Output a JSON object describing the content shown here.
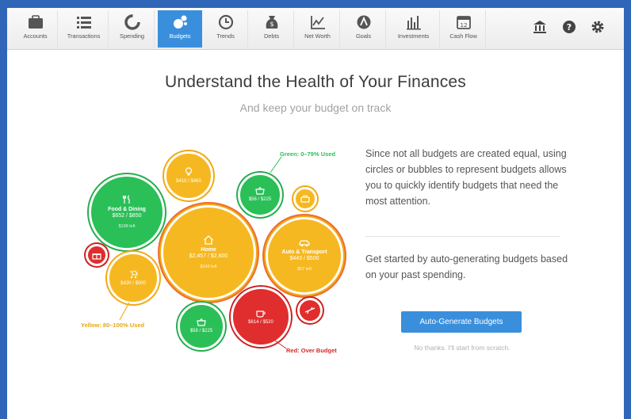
{
  "nav": {
    "tabs": [
      {
        "label": "Accounts",
        "icon": "briefcase-icon"
      },
      {
        "label": "Transactions",
        "icon": "list-icon"
      },
      {
        "label": "Spending",
        "icon": "pie-chart-icon"
      },
      {
        "label": "Budgets",
        "icon": "bubbles-icon",
        "active": true
      },
      {
        "label": "Trends",
        "icon": "clock-icon"
      },
      {
        "label": "Debts",
        "icon": "money-bag-icon"
      },
      {
        "label": "Net Worth",
        "icon": "line-chart-icon"
      },
      {
        "label": "Goals",
        "icon": "goal-icon"
      },
      {
        "label": "Investments",
        "icon": "bar-chart-icon"
      },
      {
        "label": "Cash Flow",
        "icon": "calendar-icon"
      }
    ],
    "tools": [
      {
        "icon": "bank-icon"
      },
      {
        "icon": "help-icon"
      },
      {
        "icon": "settings-icon"
      }
    ]
  },
  "header": {
    "title": "Understand the Health of Your Finances",
    "subtitle": "And keep your budget on track"
  },
  "bubbles": {
    "food": {
      "name": "Food & Dining",
      "amount": "$652 / $850",
      "left": "$198 left",
      "status": "green"
    },
    "bulb": {
      "amount": "$410 / $460",
      "status": "yellow"
    },
    "basket_top": {
      "amount": "$56 / $225",
      "status": "green"
    },
    "briefcase_small": {
      "status": "yellow"
    },
    "gift": {
      "status": "red"
    },
    "home": {
      "name": "Home",
      "amount": "$2,457 / $2,600",
      "left": "$143 left",
      "status": "yellow"
    },
    "auto": {
      "name": "Auto & Transport",
      "amount": "$443 / $500",
      "left": "$57 left",
      "status": "yellow"
    },
    "kids": {
      "amount": "$420 / $500",
      "status": "yellow"
    },
    "basket_bottom": {
      "amount": "$58 / $225",
      "status": "green"
    },
    "coffee": {
      "amount": "$614 / $520",
      "status": "red"
    },
    "plane": {
      "status": "red"
    }
  },
  "legend": {
    "green": "Green: 0–79% Used",
    "yellow": "Yellow: 80–100% Used",
    "red": "Red: Over Budget"
  },
  "colors": {
    "green": "#2bbf58",
    "yellow": "#f6b821",
    "red": "#e02d2d",
    "accent": "#3a8fdc"
  },
  "content": {
    "paragraph1": "Since not all budgets are created equal, using circles or bubbles to represent budgets allows you to quickly identify budgets that need the most attention.",
    "paragraph2": "Get started by auto-generating budgets based on your past spending.",
    "cta_label": "Auto-Generate Budgets",
    "skip_label": "No thanks. I'll start from scratch."
  }
}
